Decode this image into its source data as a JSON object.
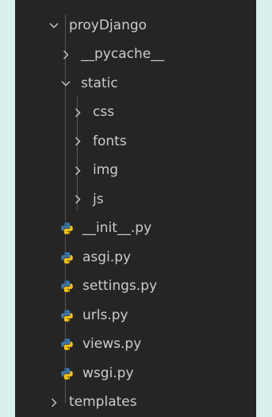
{
  "explorer": {
    "items": [
      {
        "label": "proyDjango",
        "kind": "folder",
        "expanded": true,
        "depth": 0,
        "icon": "chevron-down-icon"
      },
      {
        "label": "__pycache__",
        "kind": "folder",
        "expanded": false,
        "depth": 1,
        "icon": "chevron-right-icon"
      },
      {
        "label": "static",
        "kind": "folder",
        "expanded": true,
        "depth": 1,
        "icon": "chevron-down-icon"
      },
      {
        "label": "css",
        "kind": "folder",
        "expanded": false,
        "depth": 2,
        "icon": "chevron-right-icon"
      },
      {
        "label": "fonts",
        "kind": "folder",
        "expanded": false,
        "depth": 2,
        "icon": "chevron-right-icon"
      },
      {
        "label": "img",
        "kind": "folder",
        "expanded": false,
        "depth": 2,
        "icon": "chevron-right-icon"
      },
      {
        "label": "js",
        "kind": "folder",
        "expanded": false,
        "depth": 2,
        "icon": "chevron-right-icon"
      },
      {
        "label": "__init__.py",
        "kind": "file",
        "depth": 1,
        "icon": "python-file-icon"
      },
      {
        "label": "asgi.py",
        "kind": "file",
        "depth": 1,
        "icon": "python-file-icon"
      },
      {
        "label": "settings.py",
        "kind": "file",
        "depth": 1,
        "icon": "python-file-icon"
      },
      {
        "label": "urls.py",
        "kind": "file",
        "depth": 1,
        "icon": "python-file-icon"
      },
      {
        "label": "views.py",
        "kind": "file",
        "depth": 1,
        "icon": "python-file-icon"
      },
      {
        "label": "wsgi.py",
        "kind": "file",
        "depth": 1,
        "icon": "python-file-icon"
      },
      {
        "label": "templates",
        "kind": "folder",
        "expanded": false,
        "depth": 0,
        "icon": "chevron-right-icon"
      }
    ]
  },
  "colors": {
    "page_background": "#d9f1ec",
    "panel_background": "#252526",
    "text": "#cccccc",
    "python_blue": "#3b77a8",
    "python_yellow": "#f1c21b"
  }
}
